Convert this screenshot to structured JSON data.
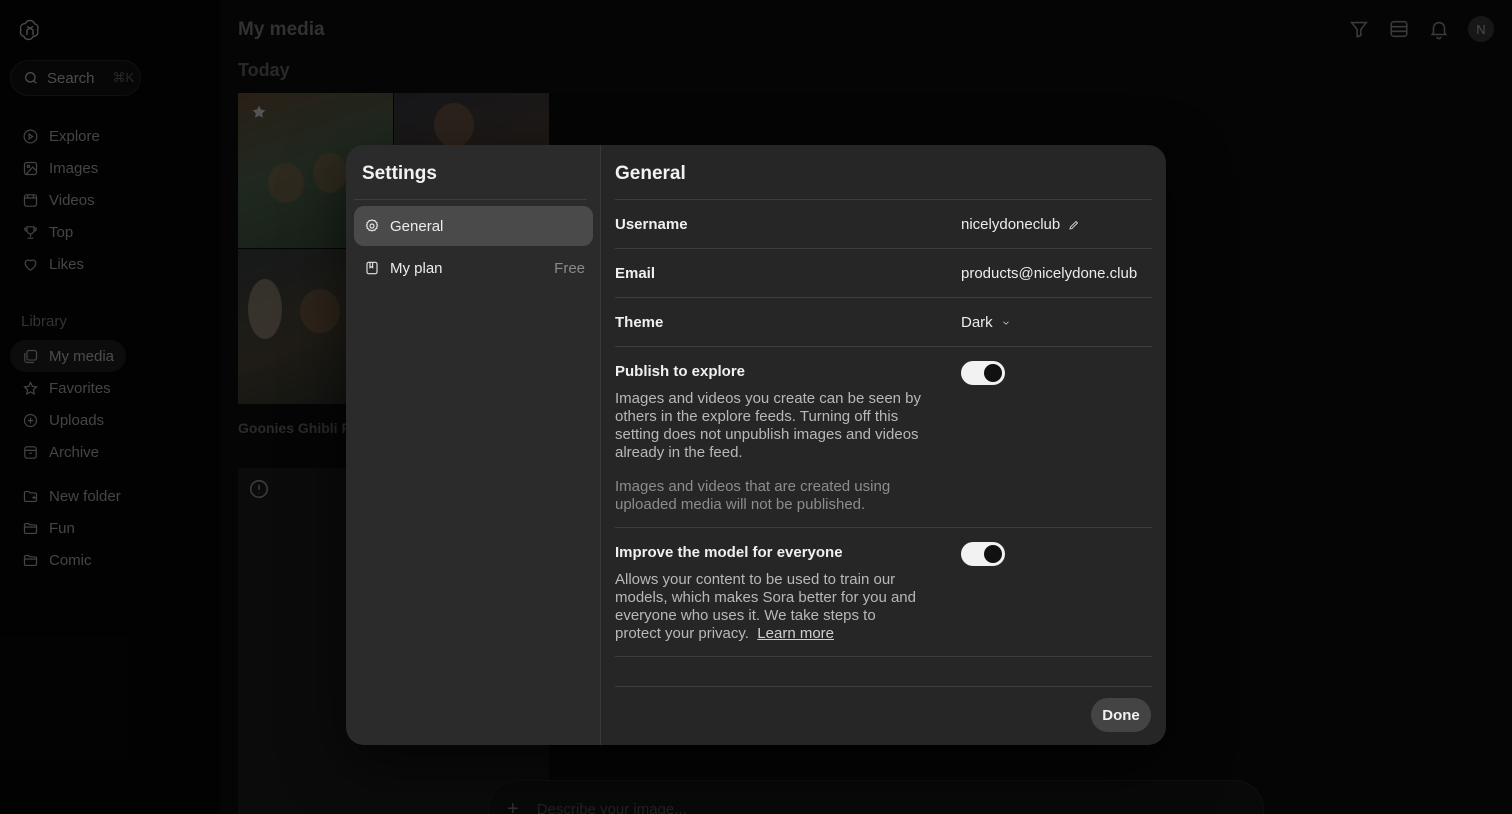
{
  "sidebar": {
    "search": {
      "label": "Search",
      "shortcut": "⌘K"
    },
    "nav": [
      {
        "label": "Explore",
        "icon": "compass-icon"
      },
      {
        "label": "Images",
        "icon": "image-icon"
      },
      {
        "label": "Videos",
        "icon": "video-icon"
      },
      {
        "label": "Top",
        "icon": "trophy-icon"
      },
      {
        "label": "Likes",
        "icon": "heart-icon"
      }
    ],
    "library_label": "Library",
    "library": [
      {
        "label": "My media",
        "icon": "media-icon",
        "active": true
      },
      {
        "label": "Favorites",
        "icon": "star-icon"
      },
      {
        "label": "Uploads",
        "icon": "upload-icon"
      },
      {
        "label": "Archive",
        "icon": "archive-icon"
      }
    ],
    "folders": [
      {
        "label": "New folder",
        "icon": "new-folder-icon"
      },
      {
        "label": "Fun",
        "icon": "folder-icon"
      },
      {
        "label": "Comic",
        "icon": "folder-icon"
      }
    ]
  },
  "main": {
    "title": "My media",
    "day_label": "Today",
    "thumb_caption": "Goonies Ghibli F",
    "prompt_placeholder": "Describe your image...",
    "avatar_initial": "N"
  },
  "modal": {
    "title": "Settings",
    "side_items": [
      {
        "label": "General",
        "active": true
      },
      {
        "label": "My plan",
        "badge": "Free"
      }
    ],
    "section_title": "General",
    "username_label": "Username",
    "username_value": "nicelydoneclub",
    "email_label": "Email",
    "email_value": "products@nicelydone.club",
    "theme_label": "Theme",
    "theme_value": "Dark",
    "publish": {
      "label": "Publish to explore",
      "enabled": true,
      "desc": "Images and videos you create can be seen by others in the explore feeds. Turning off this setting does not unpublish images and videos already in the feed.",
      "note": "Images and videos that are created using uploaded media will not be published."
    },
    "improve": {
      "label": "Improve the model for everyone",
      "enabled": true,
      "desc": "Allows your content to be used to train our models, which makes Sora better for you and everyone who uses it. We take steps to protect your privacy.",
      "link": "Learn more"
    },
    "done_label": "Done"
  }
}
